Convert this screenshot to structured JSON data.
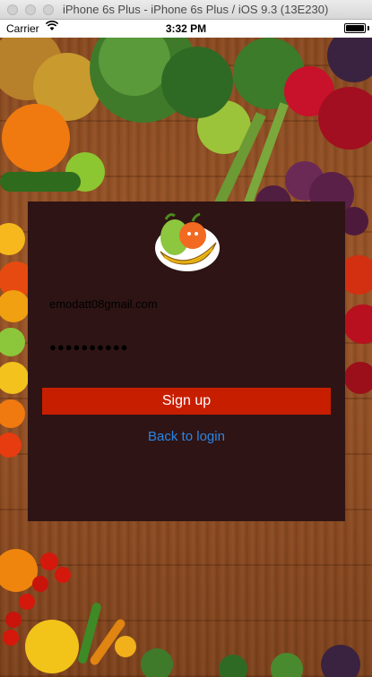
{
  "window": {
    "title": "iPhone 6s Plus - iPhone 6s Plus / iOS 9.3 (13E230)"
  },
  "status_bar": {
    "carrier": "Carrier",
    "time": "3:32 PM",
    "battery_level": 1.0
  },
  "login": {
    "email_value": "emodatt08gmail.com",
    "password_value": "●●●●●●●●●●",
    "signup_label": "Sign up",
    "back_label": "Back to login"
  },
  "colors": {
    "panel": "#2e1414",
    "signup_button": "#c81e00",
    "link": "#2a86e6"
  },
  "icons": [
    "wifi-icon",
    "battery-icon",
    "fruit-logo-icon"
  ]
}
